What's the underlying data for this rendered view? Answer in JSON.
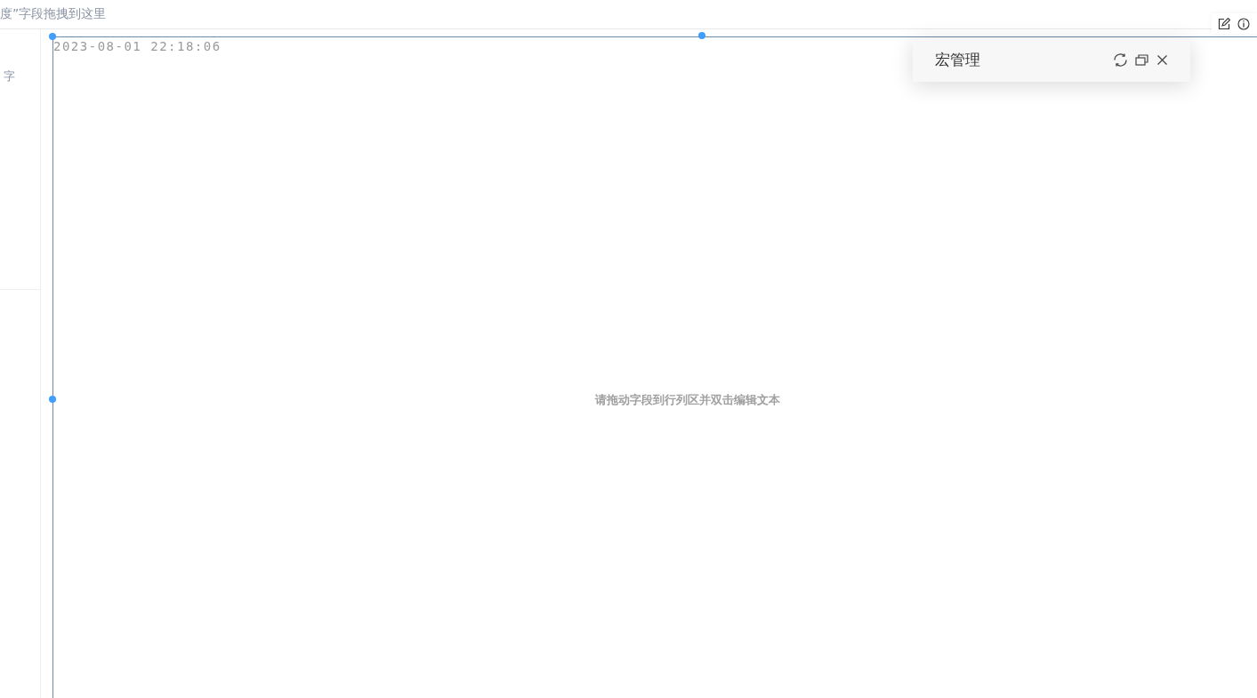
{
  "top_bar": {
    "hint": "度”字段拖拽到这里"
  },
  "left_panel": {
    "label": "字"
  },
  "canvas": {
    "timestamp": "2023-08-01 22:18:06",
    "placeholder_text": "请拖动字段到行列区并双击编辑文本"
  },
  "macro_panel": {
    "title": "宏管理"
  }
}
